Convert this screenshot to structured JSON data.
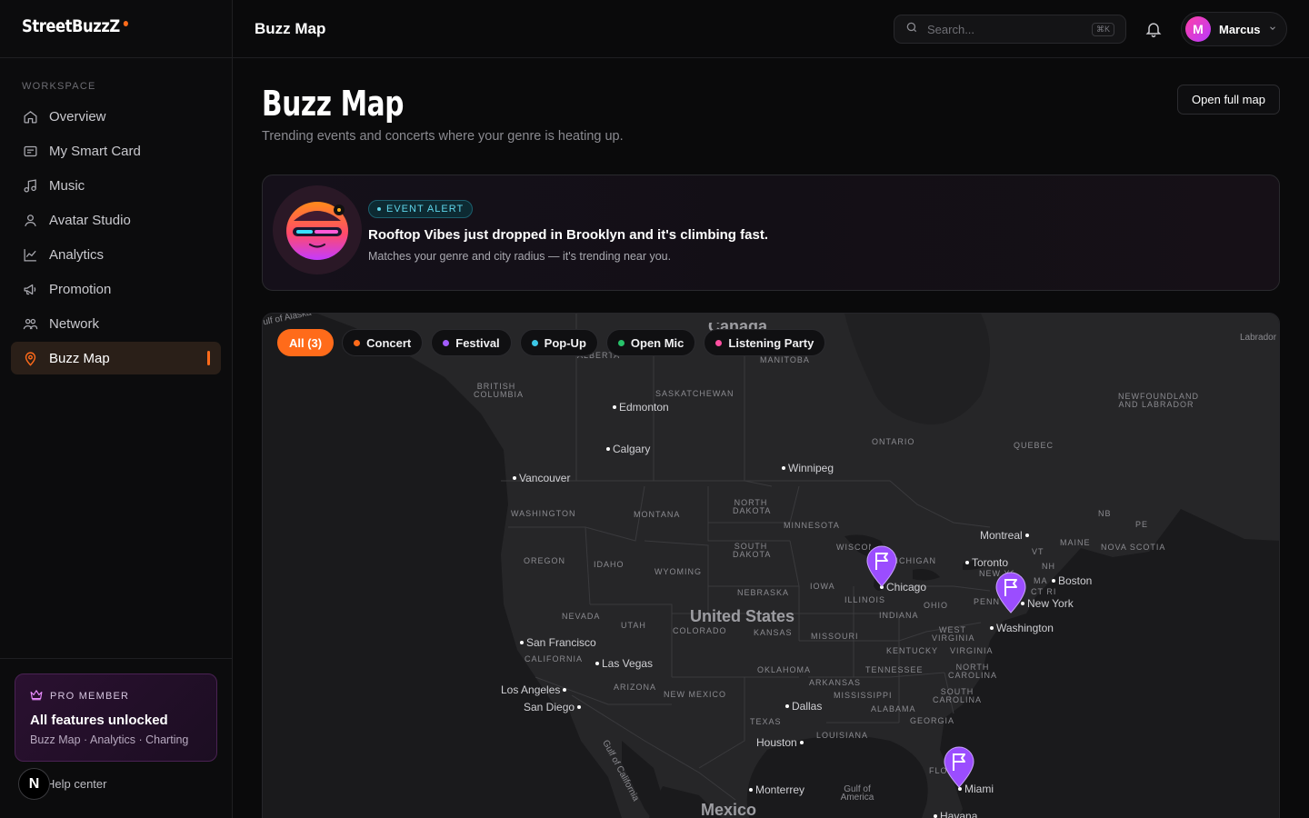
{
  "brand": {
    "name": "StreetBuzzZ"
  },
  "sidebar": {
    "section_label": "WORKSPACE",
    "items": [
      {
        "label": "Overview",
        "icon": "home-icon"
      },
      {
        "label": "My Smart Card",
        "icon": "card-icon"
      },
      {
        "label": "Music",
        "icon": "music-note-icon"
      },
      {
        "label": "Avatar Studio",
        "icon": "user-icon"
      },
      {
        "label": "Analytics",
        "icon": "chart-line-icon"
      },
      {
        "label": "Promotion",
        "icon": "megaphone-icon"
      },
      {
        "label": "Network",
        "icon": "people-icon"
      },
      {
        "label": "Buzz Map",
        "icon": "map-pin-icon",
        "active": true
      }
    ],
    "pro": {
      "tag": "PRO MEMBER",
      "title": "All features unlocked",
      "subtitle": "Buzz Map · Analytics · Charting"
    },
    "help_label": "Help center",
    "help_badge": "N"
  },
  "topbar": {
    "title": "Buzz Map",
    "search_placeholder": "Search...",
    "search_shortcut": "⌘K",
    "user_initial": "M",
    "user_name": "Marcus"
  },
  "page": {
    "title": "Buzz Map",
    "subtitle": "Trending events and concerts where your genre is heating up.",
    "open_full_map": "Open full map"
  },
  "alert": {
    "tag": "EVENT ALERT",
    "title": "Rooftop Vibes just dropped in Brooklyn and it's climbing fast.",
    "subtitle": "Matches your genre and city radius — it's trending near you."
  },
  "map": {
    "filters": [
      {
        "label": "All (3)",
        "active": true,
        "color": ""
      },
      {
        "label": "Concert",
        "color": "#ff6b1a"
      },
      {
        "label": "Festival",
        "color": "#a35cff"
      },
      {
        "label": "Pop-Up",
        "color": "#3cc7e6"
      },
      {
        "label": "Open Mic",
        "color": "#27c26a"
      },
      {
        "label": "Listening Party",
        "color": "#ff4fa0"
      }
    ],
    "regions": {
      "british_columbia": "BRITISH COLUMBIA",
      "alberta": "ALBERTA",
      "saskatchewan": "SASKATCHEWAN",
      "manitoba": "MANITOBA",
      "ontario": "ONTARIO",
      "quebec": "QUEBEC",
      "newfoundland": "NEWFOUNDLAND AND LABRADOR",
      "nb": "NB",
      "pe": "PE",
      "nova_scotia": "NOVA SCOTIA",
      "washington": "WASHINGTON",
      "oregon": "OREGON",
      "idaho": "IDAHO",
      "montana": "MONTANA",
      "wyoming": "WYOMING",
      "north_dakota": "NORTH DAKOTA",
      "south_dakota": "SOUTH DAKOTA",
      "nebraska": "NEBRASKA",
      "minnesota": "MINNESOTA",
      "wisconsin": "WISCONSIN",
      "michigan": "MICHIGAN",
      "iowa": "IOWA",
      "illinois": "ILLINOIS",
      "indiana": "INDIANA",
      "ohio": "OHIO",
      "penn": "PENN",
      "new_york": "NEW YORK",
      "maine": "MAINE",
      "vt": "VT",
      "nh": "NH",
      "ma": "MA",
      "ct_ri": "CT RI",
      "nevada": "NEVADA",
      "utah": "UTAH",
      "colorado": "COLORADO",
      "kansas": "KANSAS",
      "missouri": "MISSOURI",
      "kentucky": "KENTUCKY",
      "west_virginia": "WEST VIRGINIA",
      "virginia": "VIRGINIA",
      "california": "CALIFORNIA",
      "arizona": "ARIZONA",
      "new_mexico": "NEW MEXICO",
      "oklahoma": "OKLAHOMA",
      "arkansas": "ARKANSAS",
      "tennessee": "TENNESSEE",
      "north_carolina": "NORTH CAROLINA",
      "south_carolina": "SOUTH CAROLINA",
      "mississippi": "MISSISSIPPI",
      "alabama": "ALABAMA",
      "georgia": "GEORGIA",
      "texas": "TEXAS",
      "louisiana": "LOUISIANA",
      "florida": "FLO",
      "labrador": "Labrador",
      "gulf_of_alaska": "ulf of Alaska",
      "gulf_of_california": "Gulf of California",
      "gulf_of_america": "Gulf of America"
    },
    "countries": {
      "canada": "Canada",
      "us": "United States",
      "mexico": "Mexico"
    },
    "cities": [
      {
        "name": "Edmonton"
      },
      {
        "name": "Calgary"
      },
      {
        "name": "Vancouver"
      },
      {
        "name": "Winnipeg"
      },
      {
        "name": "Montreal"
      },
      {
        "name": "Toronto"
      },
      {
        "name": "Boston"
      },
      {
        "name": "New York"
      },
      {
        "name": "Washington"
      },
      {
        "name": "Chicago"
      },
      {
        "name": "San Francisco"
      },
      {
        "name": "Las Vegas"
      },
      {
        "name": "Los Angeles"
      },
      {
        "name": "San Diego"
      },
      {
        "name": "Dallas"
      },
      {
        "name": "Houston"
      },
      {
        "name": "Monterrey"
      },
      {
        "name": "Miami"
      },
      {
        "name": "Havana"
      }
    ],
    "pin_color": "#9b4dff"
  }
}
